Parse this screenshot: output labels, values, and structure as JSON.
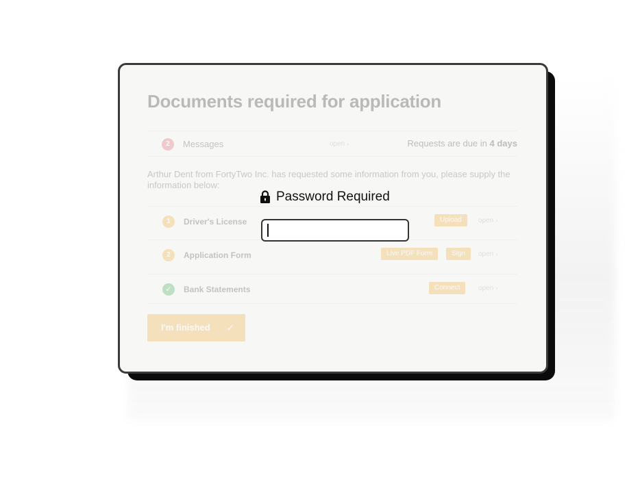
{
  "page": {
    "title": "Documents required for application"
  },
  "messages": {
    "count": "2",
    "label": "Messages",
    "open": "open",
    "due_prefix": "Requests are due in",
    "due_value": "4 days"
  },
  "intro": "Arthur Dent from FortyTwo Inc. has requested some information from you, please supply the information below:",
  "documents": [
    {
      "number": "1",
      "label": "Driver's License",
      "actions": [
        "Upload"
      ],
      "open": "open"
    },
    {
      "number": "2",
      "label": "Application Form",
      "actions": [
        "Live PDF Form",
        "Sign"
      ],
      "open": "open"
    },
    {
      "status": "complete",
      "label": "Bank Statements",
      "actions": [
        "Connect"
      ],
      "open": "open"
    }
  ],
  "finish_button": {
    "label": "I'm finished"
  },
  "password_dialog": {
    "title": "Password Required",
    "value": ""
  },
  "colors": {
    "accent": "#f0b545",
    "success": "#4caf62",
    "alert": "#e46a7a"
  }
}
